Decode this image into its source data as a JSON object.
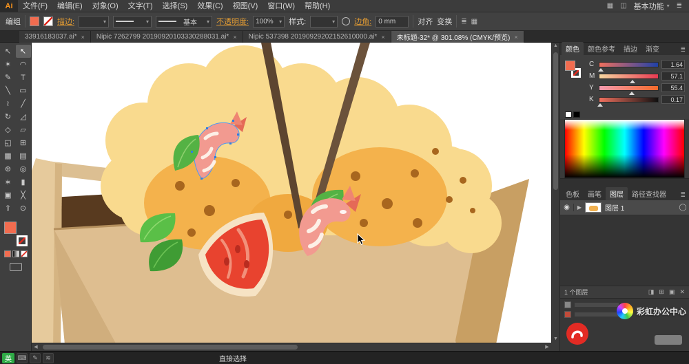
{
  "app": {
    "logo": "Ai",
    "workspace": "基本功能",
    "menu_items": [
      "文件(F)",
      "编辑(E)",
      "对象(O)",
      "文字(T)",
      "选择(S)",
      "效果(C)",
      "视图(V)",
      "窗口(W)",
      "帮助(H)"
    ]
  },
  "control_bar": {
    "context_label": "编组",
    "stroke_label": "描边:",
    "brush_value": "基本",
    "opacity_label": "不透明度:",
    "opacity_value": "100%",
    "style_label": "样式:",
    "corner_label": "边角:",
    "corner_value": "0 mm",
    "align_label": "对齐",
    "transform_label": "变换"
  },
  "document_tabs": [
    {
      "label": "33916183037.ai*",
      "active": false
    },
    {
      "label": "Nipic 7262799 20190920103330288031.ai*",
      "active": false
    },
    {
      "label": "Nipic 537398 20190929202152610000.ai*",
      "active": false
    },
    {
      "label": "未标题-32* @ 301.08% (CMYK/预览)",
      "active": true
    }
  ],
  "toolbar": {
    "tools": [
      {
        "name": "selection-tool",
        "glyph": "↖",
        "active": false
      },
      {
        "name": "direct-selection-tool",
        "glyph": "↖",
        "active": true
      },
      {
        "name": "magic-wand-tool",
        "glyph": "✶",
        "active": false
      },
      {
        "name": "lasso-tool",
        "glyph": "◠",
        "active": false
      },
      {
        "name": "pen-tool",
        "glyph": "✎",
        "active": false
      },
      {
        "name": "type-tool",
        "glyph": "T",
        "active": false
      },
      {
        "name": "line-segment-tool",
        "glyph": "╲",
        "active": false
      },
      {
        "name": "rectangle-tool",
        "glyph": "▭",
        "active": false
      },
      {
        "name": "paintbrush-tool",
        "glyph": "≀",
        "active": false
      },
      {
        "name": "pencil-tool",
        "glyph": "╱",
        "active": false
      },
      {
        "name": "rotate-tool",
        "glyph": "↻",
        "active": false
      },
      {
        "name": "scale-tool",
        "glyph": "◿",
        "active": false
      },
      {
        "name": "width-tool",
        "glyph": "◇",
        "active": false
      },
      {
        "name": "free-transform-tool",
        "glyph": "▱",
        "active": false
      },
      {
        "name": "shape-builder-tool",
        "glyph": "◱",
        "active": false
      },
      {
        "name": "perspective-grid-tool",
        "glyph": "⊞",
        "active": false
      },
      {
        "name": "mesh-tool",
        "glyph": "▦",
        "active": false
      },
      {
        "name": "gradient-tool",
        "glyph": "▤",
        "active": false
      },
      {
        "name": "eyedropper-tool",
        "glyph": "⊕",
        "active": false
      },
      {
        "name": "blend-tool",
        "glyph": "◎",
        "active": false
      },
      {
        "name": "symbol-sprayer-tool",
        "glyph": "∗",
        "active": false
      },
      {
        "name": "column-graph-tool",
        "glyph": "▮",
        "active": false
      },
      {
        "name": "artboard-tool",
        "glyph": "▣",
        "active": false
      },
      {
        "name": "slice-tool",
        "glyph": "╳",
        "active": false
      },
      {
        "name": "hand-tool",
        "glyph": "⇧",
        "active": false
      },
      {
        "name": "zoom-tool",
        "glyph": "⊙",
        "active": false
      }
    ]
  },
  "color_panel": {
    "tabs": [
      "颜色",
      "颜色参考",
      "描边",
      "渐变"
    ],
    "active_tab": "颜色",
    "channels": [
      {
        "label": "C",
        "value": "1.64",
        "percent": 2,
        "track_from": "#f0705e",
        "track_to": "#1f41a9"
      },
      {
        "label": "M",
        "value": "57.1",
        "percent": 57,
        "track_from": "#f7d7a0",
        "track_to": "#e83a52"
      },
      {
        "label": "Y",
        "value": "55.4",
        "percent": 55,
        "track_from": "#f39ab0",
        "track_to": "#f26a2a"
      },
      {
        "label": "K",
        "value": "0.17",
        "percent": 1,
        "track_from": "#f0705e",
        "track_to": "#101010"
      }
    ]
  },
  "dock_panel": {
    "tabs": [
      "色板",
      "画笔",
      "图层",
      "路径查找器"
    ],
    "active_tab": "图层",
    "layers": [
      {
        "name": "图层 1"
      }
    ],
    "status": "1 个图层"
  },
  "status_bar": {
    "current_tool": "直接选择"
  },
  "taskbar": {
    "ime_label": "英"
  },
  "watermark": {
    "text": "彩虹办公中心"
  },
  "colors": {
    "accent_fill": "#f26c4f",
    "ui_dark": "#3c3c3c",
    "selection_blue": "#2f7fe0"
  }
}
